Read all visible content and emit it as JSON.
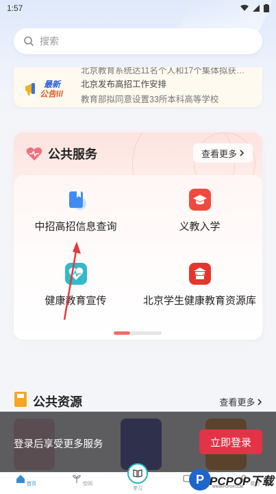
{
  "status_bar": {
    "time": "1:57"
  },
  "search": {
    "placeholder": "搜索"
  },
  "notice": {
    "badge_line1": "最新",
    "badge_line2": "公告lll",
    "items": [
      "北京教育系统达11名个人和17个集体拟获…",
      "北京发布高招工作安排",
      "教育部拟同意设置33所本科高等学校"
    ]
  },
  "public_service": {
    "title": "公共服务",
    "more_label": "查看更多",
    "items": [
      {
        "label": "中招高招信息查询",
        "icon": "bookmark-book-icon",
        "color": "#3f8df2"
      },
      {
        "label": "义教入学",
        "icon": "graduation-cap-icon",
        "color": "#ef4a3f"
      },
      {
        "label": "健康教育宣传",
        "icon": "heartbeat-icon",
        "color": "#33b9c8"
      },
      {
        "label": "北京学生健康教育资源库",
        "icon": "temple-icon",
        "color": "#e6342e"
      }
    ]
  },
  "public_resources": {
    "title": "公共资源",
    "more_label": "查看更多"
  },
  "login_overlay": {
    "message": "登录后享受更多服务",
    "button_label": "立即登录"
  },
  "tabbar": {
    "items": [
      {
        "label": "首页"
      },
      {
        "label": "空间"
      },
      {
        "label": "学习"
      },
      {
        "label": "消息"
      },
      {
        "label": "我的"
      }
    ]
  },
  "watermark": {
    "logo": "P",
    "text": "PCPOP下载",
    "sub": "WWW.PCPOP.COM"
  },
  "colors": {
    "accent_red": "#e33347",
    "accent_blue": "#3a8bd4",
    "teal": "#1fb6c1"
  }
}
